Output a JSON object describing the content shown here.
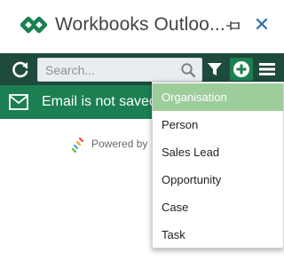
{
  "app": {
    "title": "Workbooks Outloo..."
  },
  "toolbar": {
    "search_placeholder": "Search...",
    "icons": [
      "refresh-icon",
      "search-icon",
      "filter-icon",
      "plus-circle-icon",
      "hamburger-menu-icon"
    ]
  },
  "banner": {
    "text": "Email is not saved"
  },
  "footer": {
    "powered_text": "Powered by"
  },
  "dropdown": {
    "items": [
      {
        "label": "Organisation"
      },
      {
        "label": "Person"
      },
      {
        "label": "Sales Lead"
      },
      {
        "label": "Opportunity"
      },
      {
        "label": "Case"
      },
      {
        "label": "Task"
      }
    ]
  },
  "colors": {
    "toolbar_bg": "#1f4a3e",
    "banner_bg": "#1b7f52",
    "active_item_bg": "#9ecd9c",
    "brand_green": "#1d8050",
    "close_blue": "#2b6cb0"
  }
}
